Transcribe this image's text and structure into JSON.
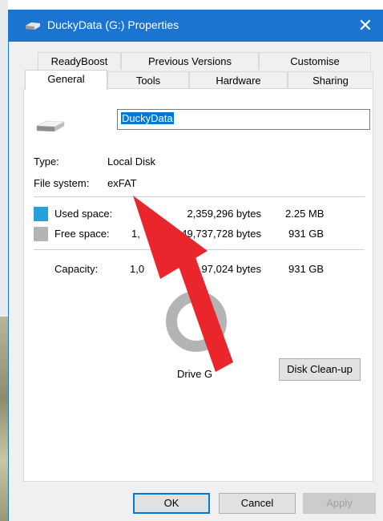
{
  "window": {
    "title": "DuckyData (G:) Properties",
    "close_glyph": "✕",
    "accent": "#1b75d0"
  },
  "tabs": {
    "row1": [
      "ReadyBoost",
      "Previous Versions",
      "Customise"
    ],
    "row2": [
      "General",
      "Tools",
      "Hardware",
      "Sharing"
    ],
    "active": "General"
  },
  "general": {
    "volume_name": "DuckyData",
    "type_label": "Type:",
    "type_value": "Local Disk",
    "fs_label": "File system:",
    "fs_value": "exFAT",
    "used": {
      "label": "Used space:",
      "bytes": "2,359,296 bytes",
      "size": "2.25 MB",
      "color": "#26a0da"
    },
    "free": {
      "label": "Free space:",
      "bytes_start": "1,",
      "bytes_end": "049,737,728 bytes",
      "size": "931 GB",
      "color": "#b4b4b4"
    },
    "capacity": {
      "label": "Capacity:",
      "bytes_start": "1,0",
      "bytes_end": "97,024 bytes",
      "size": "931 GB"
    },
    "drive_label": "Drive G",
    "cleanup_button": "Disk Clean-up",
    "used_fraction": 2.4e-06
  },
  "buttons": {
    "ok": "OK",
    "cancel": "Cancel",
    "apply": "Apply"
  },
  "annotation": {
    "arrow_color": "#e8262b",
    "points_to": "exFAT"
  }
}
